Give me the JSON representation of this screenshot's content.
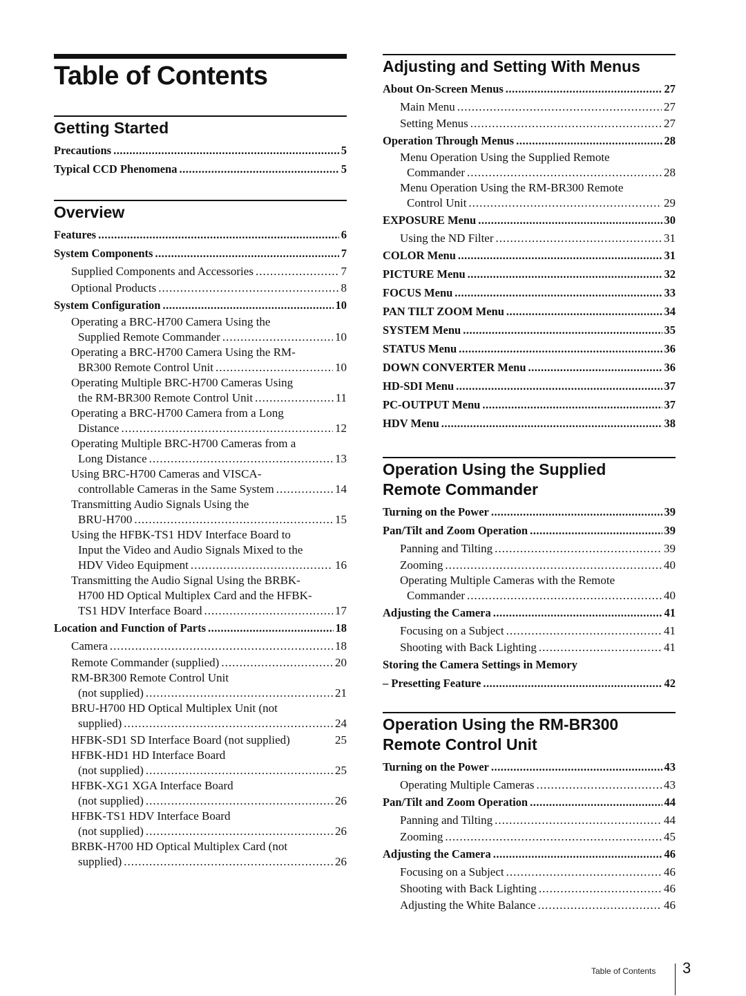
{
  "title": "Table of Contents",
  "left": [
    {
      "title": "Getting Started",
      "entries": [
        {
          "level": 1,
          "label": "Precautions",
          "page": "5"
        },
        {
          "level": 1,
          "label": "Typical CCD Phenomena",
          "page": "5"
        }
      ]
    },
    {
      "title": "Overview",
      "entries": [
        {
          "level": 1,
          "label": "Features",
          "page": "6"
        },
        {
          "level": 1,
          "label": "System Components",
          "page": "7"
        },
        {
          "level": 2,
          "label": "Supplied Components and Accessories",
          "page": "7"
        },
        {
          "level": 2,
          "label": "Optional Products",
          "page": "8"
        },
        {
          "level": 1,
          "label": "System Configuration",
          "page": "10"
        },
        {
          "level": 2,
          "lines": [
            "Operating a BRC-H700 Camera Using the",
            "Supplied Remote Commander"
          ],
          "page": "10"
        },
        {
          "level": 2,
          "lines": [
            "Operating a BRC-H700 Camera Using the RM-",
            "BR300 Remote Control Unit"
          ],
          "page": "10"
        },
        {
          "level": 2,
          "lines": [
            "Operating Multiple BRC-H700 Cameras Using",
            "the RM-BR300 Remote Control Unit"
          ],
          "page": "11"
        },
        {
          "level": 2,
          "lines": [
            "Operating a BRC-H700 Camera from a Long",
            "Distance"
          ],
          "page": "12"
        },
        {
          "level": 2,
          "lines": [
            "Operating Multiple BRC-H700 Cameras from a",
            "Long Distance"
          ],
          "page": "13"
        },
        {
          "level": 2,
          "lines": [
            "Using BRC-H700 Cameras and VISCA-",
            "controllable Cameras in the Same System"
          ],
          "page": "14"
        },
        {
          "level": 2,
          "lines": [
            "Transmitting Audio Signals Using the",
            "BRU-H700"
          ],
          "page": "15"
        },
        {
          "level": 2,
          "lines": [
            "Using the HFBK-TS1 HDV Interface Board to",
            "Input the Video and Audio Signals Mixed to the",
            "HDV Video Equipment"
          ],
          "page": "16"
        },
        {
          "level": 2,
          "lines": [
            "Transmitting the Audio Signal Using the BRBK-",
            "H700 HD Optical Multiplex Card and the HFBK-",
            "TS1 HDV Interface Board"
          ],
          "page": "17"
        },
        {
          "level": 1,
          "label": "Location and Function of Parts",
          "page": "18"
        },
        {
          "level": 2,
          "label": "Camera",
          "page": "18"
        },
        {
          "level": 2,
          "label": "Remote Commander (supplied)",
          "page": "20"
        },
        {
          "level": 2,
          "lines": [
            "RM-BR300 Remote Control Unit",
            "(not supplied)"
          ],
          "page": "21"
        },
        {
          "level": 2,
          "lines": [
            "BRU-H700 HD Optical Multiplex Unit (not",
            "supplied)"
          ],
          "page": "24"
        },
        {
          "level": 2,
          "label": "HFBK-SD1 SD Interface Board (not supplied)",
          "page": "25",
          "nodots": true
        },
        {
          "level": 2,
          "lines": [
            "HFBK-HD1 HD Interface Board",
            "(not supplied)"
          ],
          "page": "25"
        },
        {
          "level": 2,
          "lines": [
            "HFBK-XG1 XGA Interface Board",
            "(not supplied)"
          ],
          "page": "26"
        },
        {
          "level": 2,
          "lines": [
            "HFBK-TS1 HDV Interface Board",
            "(not supplied)"
          ],
          "page": "26"
        },
        {
          "level": 2,
          "lines": [
            "BRBK-H700 HD Optical Multiplex Card (not",
            "supplied)"
          ],
          "page": "26"
        }
      ]
    }
  ],
  "right": [
    {
      "title": "Adjusting and Setting With Menus",
      "entries": [
        {
          "level": 1,
          "label": "About On-Screen Menus",
          "page": "27"
        },
        {
          "level": 2,
          "label": "Main Menu",
          "page": "27"
        },
        {
          "level": 2,
          "label": "Setting Menus",
          "page": "27"
        },
        {
          "level": 1,
          "label": "Operation Through Menus",
          "page": "28"
        },
        {
          "level": 2,
          "lines": [
            "Menu Operation Using the Supplied Remote",
            "Commander"
          ],
          "page": "28"
        },
        {
          "level": 2,
          "lines": [
            "Menu Operation Using the RM-BR300 Remote",
            "Control Unit"
          ],
          "page": "29"
        },
        {
          "level": 1,
          "label": "EXPOSURE Menu",
          "page": "30"
        },
        {
          "level": 2,
          "label": "Using the ND Filter",
          "page": "31"
        },
        {
          "level": 1,
          "label": "COLOR Menu",
          "page": "31"
        },
        {
          "level": 1,
          "label": "PICTURE Menu",
          "page": "32"
        },
        {
          "level": 1,
          "label": "FOCUS Menu",
          "page": "33"
        },
        {
          "level": 1,
          "label": "PAN TILT ZOOM Menu",
          "page": "34"
        },
        {
          "level": 1,
          "label": "SYSTEM Menu",
          "page": "35"
        },
        {
          "level": 1,
          "label": "STATUS Menu",
          "page": "36"
        },
        {
          "level": 1,
          "label": "DOWN CONVERTER Menu",
          "page": "36"
        },
        {
          "level": 1,
          "label": "HD-SDI Menu",
          "page": "37"
        },
        {
          "level": 1,
          "label": "PC-OUTPUT Menu",
          "page": "37"
        },
        {
          "level": 1,
          "label": "HDV Menu",
          "page": "38"
        }
      ]
    },
    {
      "title": "Operation Using the Supplied Remote Commander",
      "title_lines": [
        "Operation Using the Supplied",
        "Remote Commander"
      ],
      "entries": [
        {
          "level": 1,
          "label": "Turning on the Power",
          "page": "39"
        },
        {
          "level": 1,
          "label": "Pan/Tilt and Zoom Operation",
          "page": "39"
        },
        {
          "level": 2,
          "label": "Panning and Tilting",
          "page": "39"
        },
        {
          "level": 2,
          "label": "Zooming",
          "page": "40"
        },
        {
          "level": 2,
          "lines": [
            "Operating Multiple Cameras with the Remote",
            "Commander"
          ],
          "page": "40"
        },
        {
          "level": 1,
          "label": "Adjusting the Camera",
          "page": "41"
        },
        {
          "level": 2,
          "label": "Focusing on a Subject",
          "page": "41"
        },
        {
          "level": 2,
          "label": "Shooting with Back Lighting",
          "page": "41"
        },
        {
          "level": 1,
          "label": "Storing the Camera Settings in Memory",
          "page": "",
          "heading_only": true
        },
        {
          "level": 1,
          "label": "– Presetting Feature",
          "page": "42"
        }
      ]
    },
    {
      "title": "Operation Using the RM-BR300 Remote Control Unit",
      "title_lines": [
        "Operation Using the RM-BR300",
        "Remote Control Unit"
      ],
      "entries": [
        {
          "level": 1,
          "label": "Turning on the Power",
          "page": "43"
        },
        {
          "level": 2,
          "label": "Operating Multiple Cameras",
          "page": "43"
        },
        {
          "level": 1,
          "label": "Pan/Tilt and Zoom Operation",
          "page": "44"
        },
        {
          "level": 2,
          "label": "Panning and Tilting",
          "page": "44"
        },
        {
          "level": 2,
          "label": "Zooming",
          "page": "45"
        },
        {
          "level": 1,
          "label": "Adjusting the Camera",
          "page": "46"
        },
        {
          "level": 2,
          "label": "Focusing on a Subject",
          "page": "46"
        },
        {
          "level": 2,
          "label": "Shooting with Back Lighting",
          "page": "46"
        },
        {
          "level": 2,
          "label": "Adjusting the White Balance",
          "page": "46"
        }
      ]
    }
  ],
  "footer": {
    "label": "Table of Contents",
    "page_number": "3"
  }
}
